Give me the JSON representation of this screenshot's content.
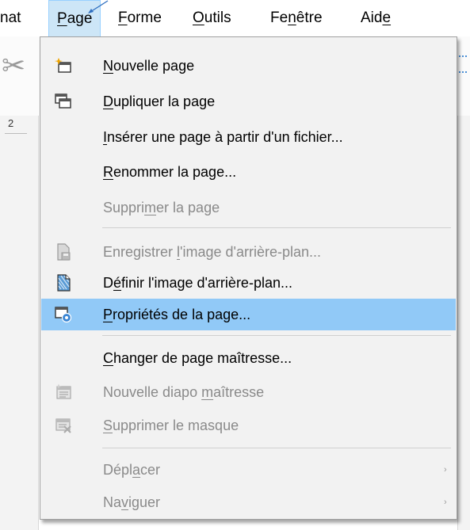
{
  "menubar": {
    "items": [
      {
        "pre": "",
        "ul": "",
        "post": "nat"
      },
      {
        "pre": "",
        "ul": "P",
        "post": "age"
      },
      {
        "pre": "",
        "ul": "F",
        "post": "orme"
      },
      {
        "pre": "",
        "ul": "O",
        "post": "utils"
      },
      {
        "pre": "Fe",
        "ul": "n",
        "post": "être"
      },
      {
        "pre": "Aid",
        "ul": "e",
        "post": ""
      }
    ]
  },
  "toolbar": {
    "ruler_number": "2"
  },
  "page_menu": {
    "items": [
      {
        "pre": "",
        "ul": "N",
        "post": "ouvelle page",
        "icon": "new-page-icon",
        "disabled": false
      },
      {
        "pre": "",
        "ul": "D",
        "post": "upliquer la page",
        "icon": "duplicate-page-icon",
        "disabled": false
      },
      {
        "pre": "",
        "ul": "I",
        "post": "nsérer une page à partir d'un fichier...",
        "icon": "",
        "disabled": false
      },
      {
        "pre": "",
        "ul": "R",
        "post": "enommer la page...",
        "icon": "",
        "disabled": false
      },
      {
        "pre": "Suppri",
        "ul": "m",
        "post": "er la page",
        "icon": "",
        "disabled": true
      },
      {
        "pre": "Enregistrer ",
        "ul": "l",
        "post": "'image d'arrière-plan...",
        "icon": "save-background-icon",
        "disabled": true
      },
      {
        "pre": "D",
        "ul": "é",
        "post": "finir l'image d'arrière-plan...",
        "icon": "set-background-icon",
        "disabled": false
      },
      {
        "pre": "",
        "ul": "P",
        "post": "ropriétés de la page...",
        "icon": "page-properties-icon",
        "disabled": false
      },
      {
        "pre": "",
        "ul": "C",
        "post": "hanger de page maîtresse...",
        "icon": "",
        "disabled": false
      },
      {
        "pre": "Nouvelle diapo ",
        "ul": "m",
        "post": "aîtresse",
        "icon": "new-master-slide-icon",
        "disabled": true
      },
      {
        "pre": "",
        "ul": "S",
        "post": "upprimer le masque",
        "icon": "delete-master-icon",
        "disabled": true
      },
      {
        "pre": "Dépl",
        "ul": "a",
        "post": "cer",
        "icon": "",
        "disabled": true,
        "submenu_arrow": "›"
      },
      {
        "pre": "Na",
        "ul": "v",
        "post": "iguer",
        "icon": "",
        "disabled": true,
        "submenu_arrow": "›"
      }
    ]
  },
  "colors": {
    "highlight": "#91c9f7",
    "active_menu": "#cde6f7",
    "disabled_text": "#8a8a8a",
    "menu_background": "#f2f2f2"
  }
}
